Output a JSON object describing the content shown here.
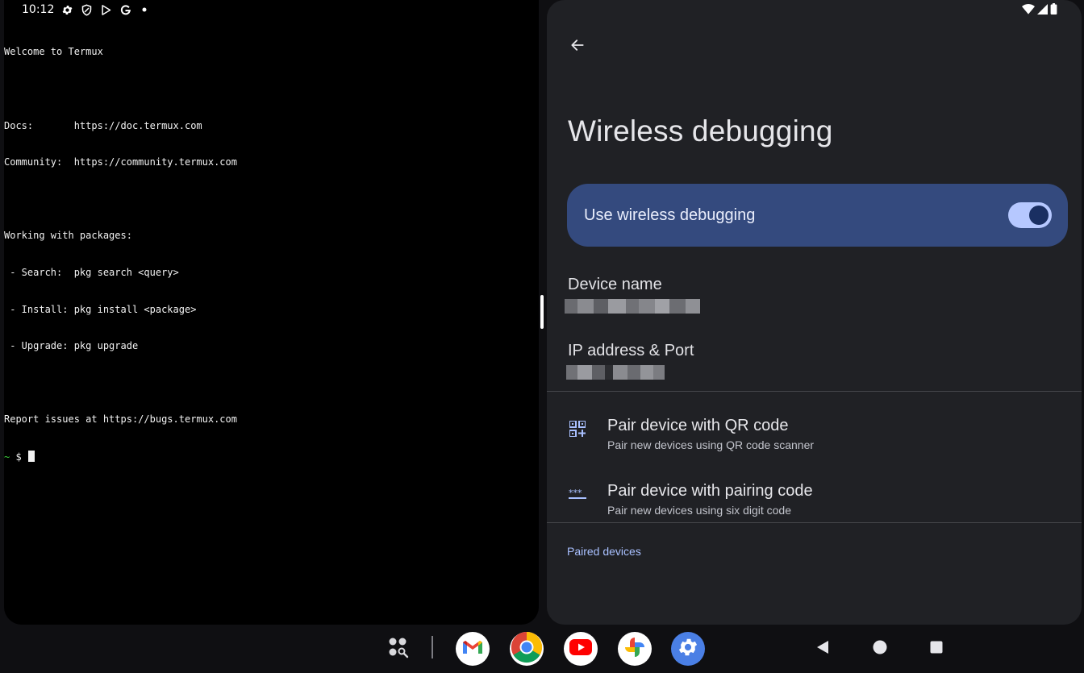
{
  "status_bar": {
    "time": "10:12",
    "icons_left": [
      "gear-icon",
      "shield-icon",
      "play-store-icon",
      "google-g-icon",
      "dot-icon"
    ],
    "icons_right": [
      "wifi-icon",
      "signal-icon",
      "battery-icon"
    ]
  },
  "terminal": {
    "lines": [
      "Welcome to Termux",
      "",
      "Docs:       https://doc.termux.com",
      "Community:  https://community.termux.com",
      "",
      "Working with packages:",
      " - Search:  pkg search <query>",
      " - Install: pkg install <package>",
      " - Upgrade: pkg upgrade",
      "",
      "Report issues at https://bugs.termux.com"
    ],
    "prompt_tilde": "~",
    "prompt_symbol": " $ "
  },
  "settings": {
    "back_icon": "arrow-back-icon",
    "title": "Wireless debugging",
    "main_switch": {
      "label": "Use wireless debugging",
      "checked": true
    },
    "device_name": {
      "title": "Device name"
    },
    "ip_address": {
      "title": "IP address & Port"
    },
    "pair_qr": {
      "title": "Pair device with QR code",
      "summary": "Pair new devices using QR code scanner",
      "icon": "qr-code-add-icon"
    },
    "pair_code": {
      "title": "Pair device with pairing code",
      "summary": "Pair new devices using six digit code",
      "icon": "password-dots-icon"
    },
    "paired_header": "Paired devices"
  },
  "taskbar": {
    "apps": [
      {
        "name": "app-drawer",
        "icon": "app-drawer-icon"
      },
      {
        "name": "gmail",
        "icon": "gmail-icon"
      },
      {
        "name": "chrome",
        "icon": "chrome-icon"
      },
      {
        "name": "youtube",
        "icon": "youtube-icon"
      },
      {
        "name": "photos",
        "icon": "photos-icon"
      },
      {
        "name": "settings",
        "icon": "settings-gear-icon"
      }
    ],
    "nav": [
      "back-nav-icon",
      "home-nav-icon",
      "recents-nav-icon"
    ]
  },
  "colors": {
    "terminal_bg": "#000000",
    "settings_bg": "#202125",
    "switch_card": "#344a7e",
    "accent": "#a9c0ff",
    "prompt_green": "#3bd13b"
  }
}
